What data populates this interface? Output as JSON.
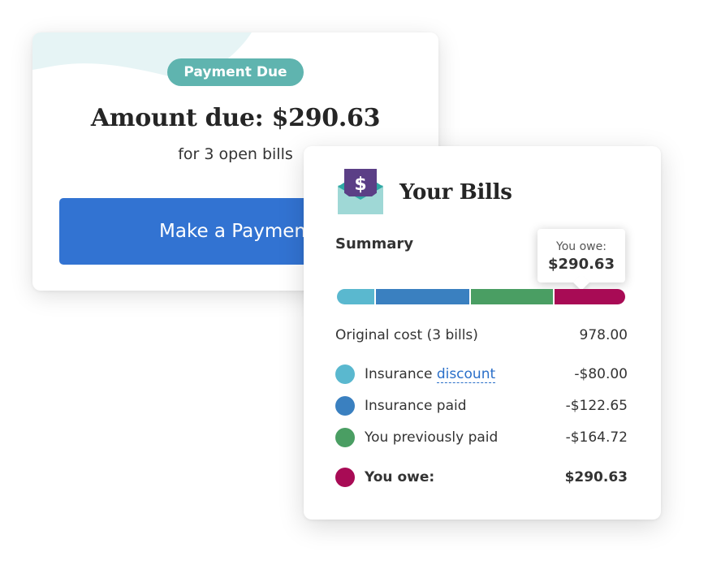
{
  "payment_card": {
    "badge": "Payment Due",
    "title": "Amount due: $290.63",
    "subtitle": "for 3 open bills",
    "button_label": "Make a Payment"
  },
  "bills_card": {
    "title": "Your Bills",
    "icon": "envelope-dollar-icon",
    "summary_label": "Summary",
    "tooltip": {
      "label": "You owe:",
      "value": "$290.63"
    },
    "bar_segments": [
      {
        "name": "Insurance discount",
        "fraction": 0.13,
        "color": "#5ab8cf"
      },
      {
        "name": "Insurance paid",
        "fraction": 0.33,
        "color": "#3a80c0"
      },
      {
        "name": "You previously paid",
        "fraction": 0.29,
        "color": "#4a9e63"
      },
      {
        "name": "You owe",
        "fraction": 0.25,
        "color": "#a80b55"
      }
    ],
    "original_cost": {
      "label": "Original cost (3 bills)",
      "value": "978.00"
    },
    "rows": [
      {
        "label_prefix": "Insurance ",
        "link": "discount",
        "value": "-$80.00",
        "color": "#5ab8cf"
      },
      {
        "label": "Insurance paid",
        "value": "-$122.65",
        "color": "#3a80c0"
      },
      {
        "label": "You previously paid",
        "value": "-$164.72",
        "color": "#4a9e63"
      }
    ],
    "total": {
      "label": "You owe:",
      "value": "$290.63",
      "color": "#a80b55"
    }
  }
}
